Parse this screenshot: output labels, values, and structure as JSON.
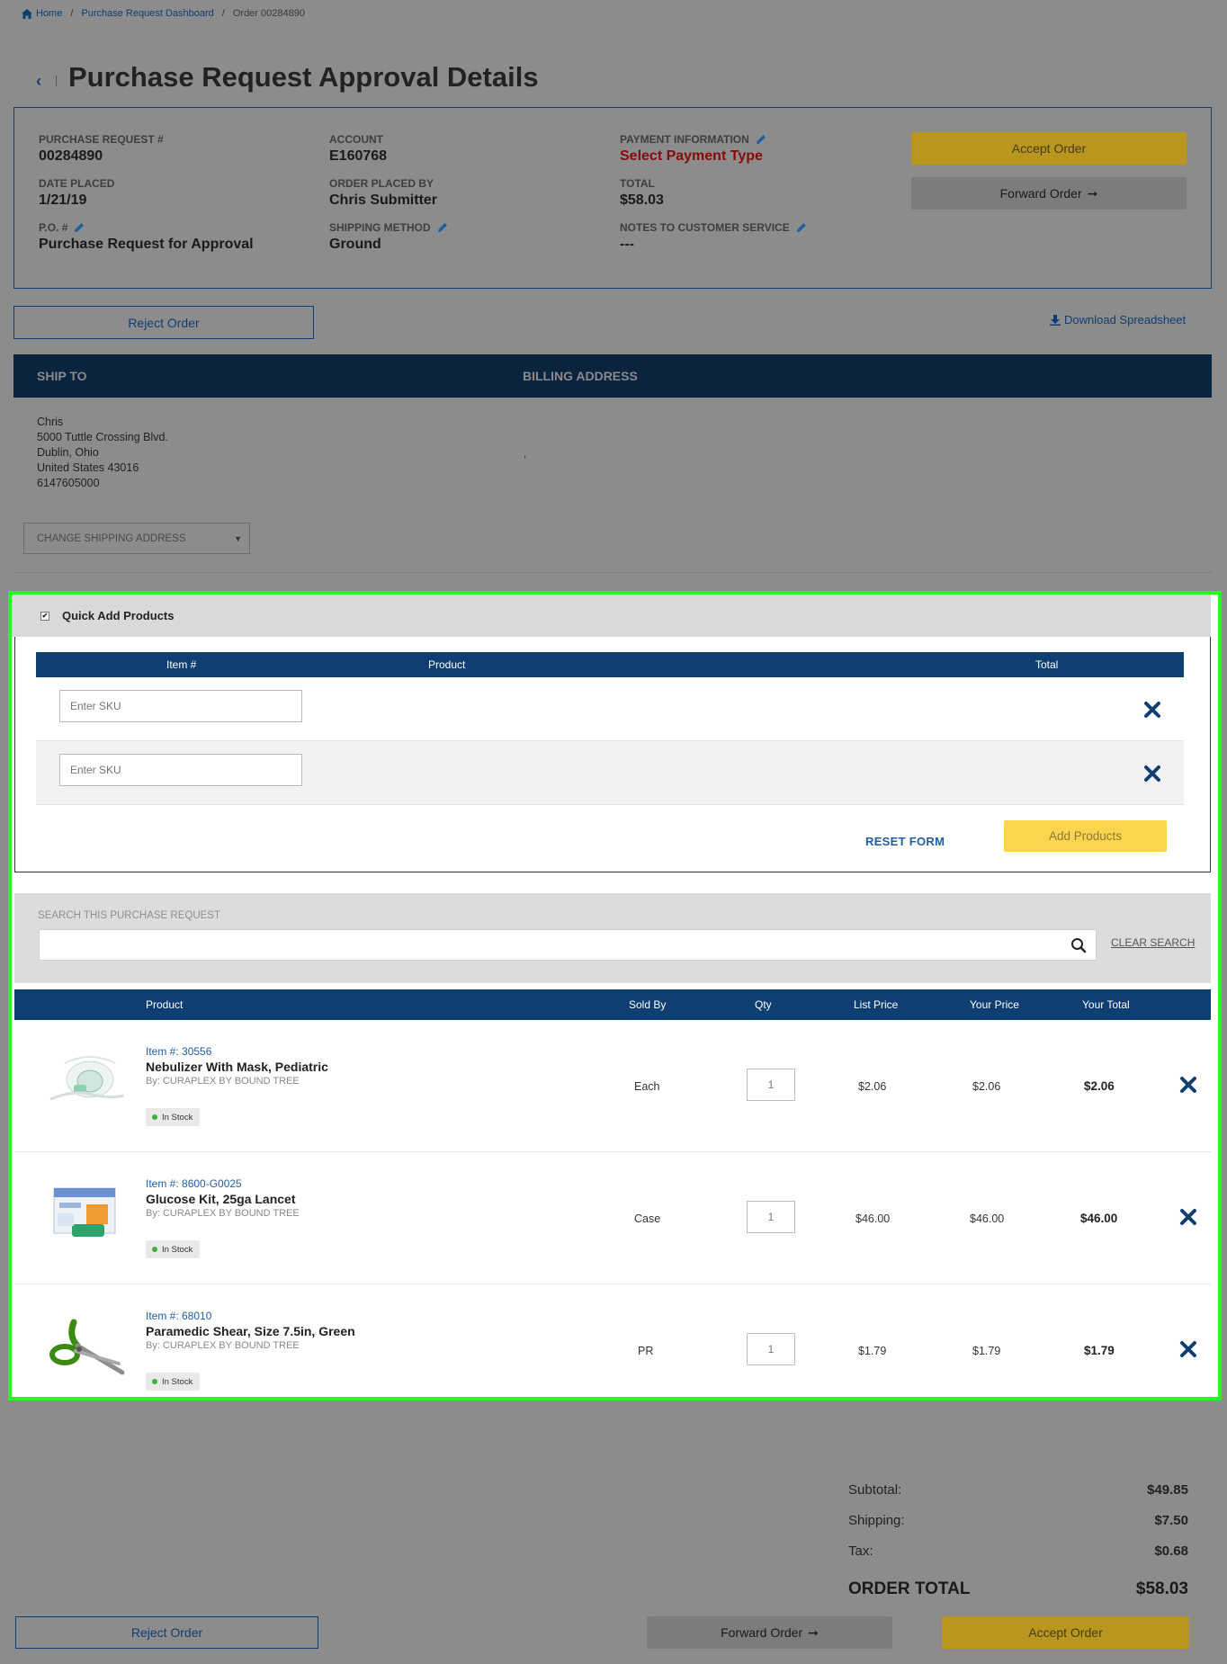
{
  "breadcrumb": {
    "home": "Home",
    "dashboard": "Purchase Request Dashboard",
    "current": "Order 00284890"
  },
  "page": {
    "title": "Purchase Request Approval Details",
    "back_icon": "chevron-left-icon"
  },
  "summary": {
    "pr_label": "PURCHASE REQUEST #",
    "pr_value": "00284890",
    "date_label": "DATE PLACED",
    "date_value": "1/21/19",
    "po_label": "P.O. #",
    "po_value": "Purchase Request for Approval",
    "account_label": "ACCOUNT",
    "account_value": "E160768",
    "placed_by_label": "ORDER PLACED BY",
    "placed_by_value": "Chris Submitter",
    "shipping_label": "SHIPPING METHOD",
    "shipping_value": "Ground",
    "payment_label": "PAYMENT INFORMATION",
    "payment_value": "Select Payment Type",
    "total_label": "TOTAL",
    "total_value": "$58.03",
    "notes_label": "NOTES TO CUSTOMER SERVICE",
    "notes_value": "---",
    "accent_red": "#8a0a0a"
  },
  "actions": {
    "accept": "Accept Order",
    "forward": "Forward Order",
    "reject": "Reject Order",
    "download": "Download Spreadsheet"
  },
  "address": {
    "ship_to_header": "SHIP TO",
    "billing_header": "BILLING ADDRESS",
    "line1": "Chris",
    "line2": "5000 Tuttle Crossing Blvd.",
    "line3": "Dublin, Ohio",
    "line4": "United States 43016",
    "line5": "6147605000",
    "billing_placeholder": ",",
    "change_shipping": "CHANGE SHIPPING ADDRESS"
  },
  "quick_add": {
    "title": "Quick Add Products",
    "col_item": "Item #",
    "col_product": "Product",
    "col_total": "Total",
    "sku_placeholder": "Enter SKU",
    "reset": "RESET FORM",
    "add": "Add Products"
  },
  "search": {
    "label": "SEARCH THIS PURCHASE REQUEST",
    "placeholder": "",
    "clear": "CLEAR SEARCH"
  },
  "table": {
    "headers": {
      "product": "Product",
      "sold_by": "Sold By",
      "qty": "Qty",
      "list_price": "List Price",
      "your_price": "Your Price",
      "your_total": "Your Total"
    },
    "rows": [
      {
        "item": "Item #: 30556",
        "name": "Nebulizer With Mask, Pediatric",
        "by": "By: CURAPLEX BY BOUND TREE",
        "stock": "In Stock",
        "sold_by": "Each",
        "qty": "1",
        "list_price": "$2.06",
        "your_price": "$2.06",
        "your_total": "$2.06"
      },
      {
        "item": "Item #: 8600-G0025",
        "name": "Glucose Kit, 25ga Lancet",
        "by": "By: CURAPLEX BY BOUND TREE",
        "stock": "In Stock",
        "sold_by": "Case",
        "qty": "1",
        "list_price": "$46.00",
        "your_price": "$46.00",
        "your_total": "$46.00"
      },
      {
        "item": "Item #: 68010",
        "name": "Paramedic Shear, Size 7.5in, Green",
        "by": "By: CURAPLEX BY BOUND TREE",
        "stock": "In Stock",
        "sold_by": "PR",
        "qty": "1",
        "list_price": "$1.79",
        "your_price": "$1.79",
        "your_total": "$1.79"
      }
    ]
  },
  "totals": {
    "subtotal_label": "Subtotal:",
    "subtotal_value": "$49.85",
    "shipping_label": "Shipping:",
    "shipping_value": "$7.50",
    "tax_label": "Tax:",
    "tax_value": "$0.68",
    "order_total_label": "ORDER TOTAL",
    "order_total_value": "$58.03"
  },
  "colors": {
    "navy": "#0f3e73",
    "highlight": "#1eff1e",
    "accept_yellow": "#b8961f",
    "add_yellow": "#fad54d"
  }
}
